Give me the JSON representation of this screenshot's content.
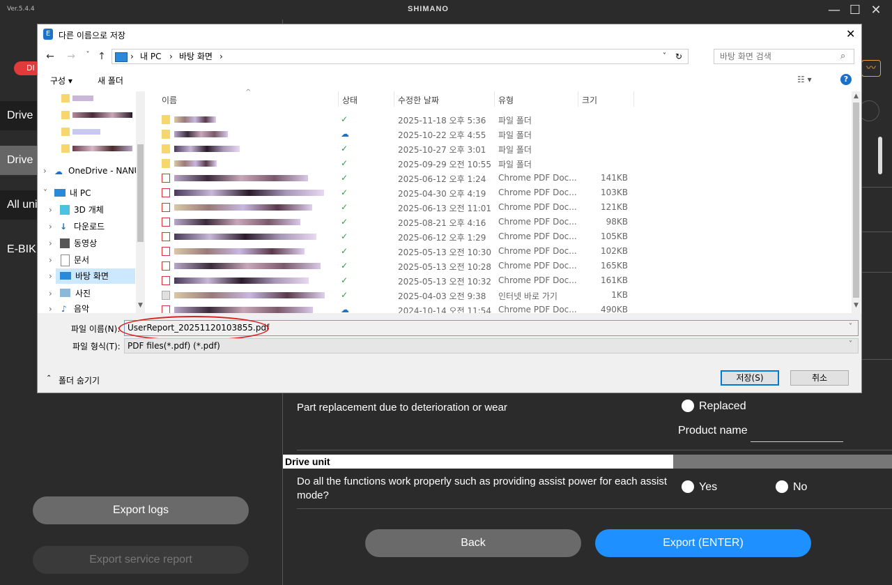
{
  "app": {
    "version": "Ver.5.4.4",
    "brand": "SHIMANO",
    "controls": {
      "minimize": "—",
      "maximize": "☐",
      "close": "✕"
    },
    "badge": "DI"
  },
  "sidebar": {
    "items": [
      {
        "label": "Drive"
      },
      {
        "label": "Drive"
      },
      {
        "label": "All uni"
      },
      {
        "label": "E-BIK"
      }
    ]
  },
  "report": {
    "replacement_question": "Part replacement due to deterioration or wear",
    "replaced_label": "Replaced",
    "product_name_label": "Product name",
    "section_title": "Drive unit",
    "drive_question": "Do all the functions work properly such as providing assist power for each assist mode?",
    "yes_label": "Yes",
    "no_label": "No"
  },
  "buttons": {
    "export_logs": "Export logs",
    "export_service_report": "Export service report",
    "back": "Back",
    "export_enter": "Export (ENTER)"
  },
  "dialog": {
    "title": "다른 이름으로 저장",
    "close": "✕",
    "nav": {
      "back": "←",
      "forward": "→",
      "recent": "˅",
      "up": "↑"
    },
    "breadcrumb": [
      "내 PC",
      "바탕 화면"
    ],
    "search_placeholder": "바탕 화면 검색",
    "toolbar": {
      "organize": "구성 ▾",
      "new_folder": "새 폴더",
      "help": "?"
    },
    "tree": [
      {
        "label": "OneDrive - NANU"
      },
      {
        "label": "내 PC"
      },
      {
        "label": "3D 개체"
      },
      {
        "label": "다운로드"
      },
      {
        "label": "동영상"
      },
      {
        "label": "문서"
      },
      {
        "label": "바탕 화면"
      },
      {
        "label": "사진"
      },
      {
        "label": "음악"
      }
    ],
    "columns": {
      "name": "이름",
      "status": "상태",
      "modified": "수정한 날짜",
      "type": "유형",
      "size": "크기"
    },
    "files": [
      {
        "date": "2025-11-18 오후 5:36",
        "type": "파일 폴더",
        "size": "",
        "status": "ok",
        "kind": "folder"
      },
      {
        "date": "2025-10-22 오후 4:55",
        "type": "파일 폴더",
        "size": "",
        "status": "cloud",
        "kind": "folder"
      },
      {
        "date": "2025-10-27 오후 3:01",
        "type": "파일 폴더",
        "size": "",
        "status": "ok",
        "kind": "folder"
      },
      {
        "date": "2025-09-29 오전 10:55",
        "type": "파일 폴더",
        "size": "",
        "status": "ok",
        "kind": "folder"
      },
      {
        "date": "2025-06-12 오후 1:24",
        "type": "Chrome PDF Doc...",
        "size": "141KB",
        "status": "ok",
        "kind": "pdf"
      },
      {
        "date": "2025-04-30 오후 4:19",
        "type": "Chrome PDF Doc...",
        "size": "103KB",
        "status": "ok",
        "kind": "pdf"
      },
      {
        "date": "2025-06-13 오전 11:01",
        "type": "Chrome PDF Doc...",
        "size": "121KB",
        "status": "ok",
        "kind": "pdf"
      },
      {
        "date": "2025-08-21 오후 4:16",
        "type": "Chrome PDF Doc...",
        "size": "98KB",
        "status": "ok",
        "kind": "pdf"
      },
      {
        "date": "2025-06-12 오후 1:29",
        "type": "Chrome PDF Doc...",
        "size": "105KB",
        "status": "ok",
        "kind": "pdf"
      },
      {
        "date": "2025-05-13 오전 10:30",
        "type": "Chrome PDF Doc...",
        "size": "102KB",
        "status": "ok",
        "kind": "pdf"
      },
      {
        "date": "2025-05-13 오전 10:28",
        "type": "Chrome PDF Doc...",
        "size": "165KB",
        "status": "ok",
        "kind": "pdf"
      },
      {
        "date": "2025-05-13 오전 10:32",
        "type": "Chrome PDF Doc...",
        "size": "161KB",
        "status": "ok",
        "kind": "pdf"
      },
      {
        "date": "2025-04-03 오전 9:38",
        "type": "인터넷 바로 가기",
        "size": "1KB",
        "status": "ok",
        "kind": "link"
      },
      {
        "date": "2024-10-14 오전 11:54",
        "type": "Chrome PDF Doc...",
        "size": "490KB",
        "status": "cloud",
        "kind": "pdf"
      }
    ],
    "filename_label": "파일 이름(N):",
    "filename_value": "UserReport_20251120103855.pdf",
    "filetype_label": "파일 형식(T):",
    "filetype_value": "PDF files(*.pdf) (*.pdf)",
    "hide_folders": "폴더 숨기기",
    "save": "저장(S)",
    "cancel": "취소"
  },
  "colors": {
    "accent_blue": "#1e90ff",
    "annotation_red": "#d82020",
    "status_green": "#2a9d3a"
  }
}
